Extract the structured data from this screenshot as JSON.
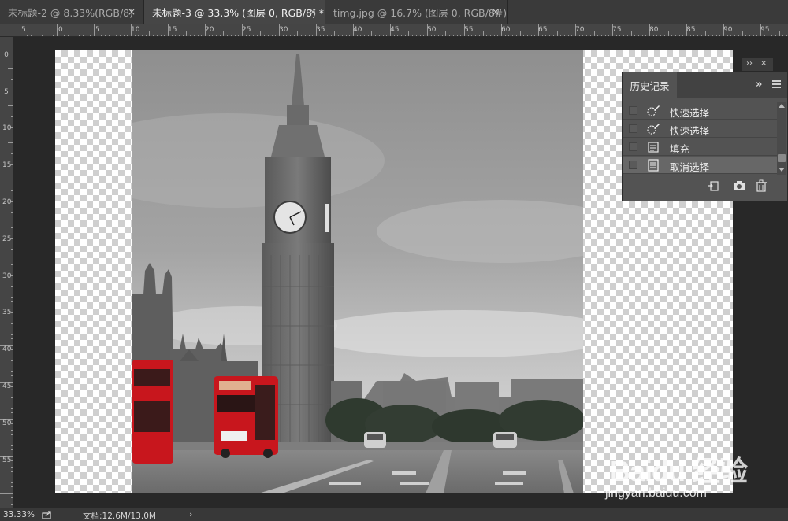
{
  "tabs": [
    {
      "label": "未标题-2 @ 8.33%(RGB/8)",
      "close": "×",
      "active": false
    },
    {
      "label": "未标题-3 @ 33.3% (图层 0, RGB/8) *",
      "close": "×",
      "active": true
    },
    {
      "label": "timg.jpg @ 16.7% (图层 0, RGB/8#) *",
      "close": "×",
      "active": false
    }
  ],
  "ruler": {
    "horizontal": [
      "5",
      "0",
      "5",
      "10",
      "15",
      "20",
      "25",
      "30",
      "35",
      "40",
      "45",
      "50",
      "55",
      "60",
      "65",
      "70",
      "75",
      "80",
      "85",
      "90",
      "95"
    ],
    "vertical": [
      "0",
      "5",
      "10",
      "15",
      "20",
      "25",
      "30",
      "35",
      "40",
      "45",
      "50",
      "55"
    ]
  },
  "history_panel": {
    "title": "历史记录",
    "collapse_glyph": "»",
    "dock_glyphs": [
      "››",
      "×"
    ],
    "items": [
      {
        "label": "快速选择",
        "icon": "quick-selection-icon",
        "selected": false
      },
      {
        "label": "快速选择",
        "icon": "quick-selection-icon",
        "selected": false
      },
      {
        "label": "填充",
        "icon": "fill-doc-icon",
        "selected": false
      },
      {
        "label": "取消选择",
        "icon": "doc-icon",
        "selected": true
      }
    ],
    "footer_icons": [
      "new-document-from-state-icon",
      "snapshot-camera-icon",
      "trash-icon"
    ]
  },
  "status_bar": {
    "zoom": "33.33%",
    "doc_info": "文档:12.6M/13.0M",
    "arrow": "›"
  },
  "watermark": {
    "big": "Baidu 经验",
    "small": "jingyan.baidu.com"
  },
  "colors": {
    "background": "#282828",
    "panel": "#535353",
    "bus_red": "#c8161d"
  }
}
